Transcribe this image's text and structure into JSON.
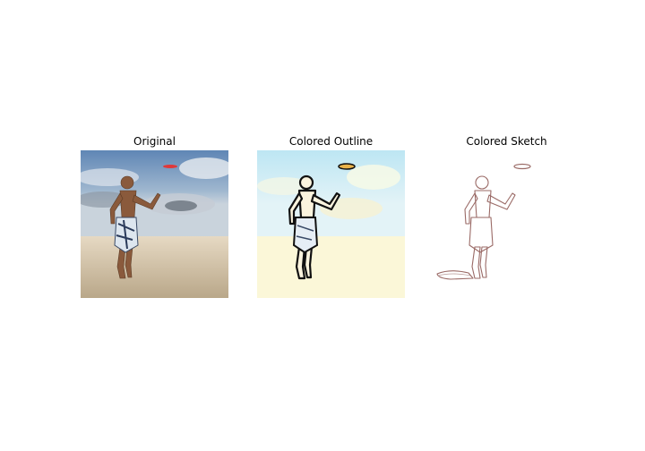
{
  "figure": {
    "panels": [
      {
        "title": "Original"
      },
      {
        "title": "Colored Outline"
      },
      {
        "title": "Colored Sketch"
      }
    ]
  },
  "colors": {
    "sky_blue": "#7fa3c8",
    "sand": "#d9c9ae",
    "skin": "#8a5a3c",
    "frisbee": "#e0383a",
    "outline_sky": "#bfe7f2",
    "outline_sand": "#fbf6d9",
    "sketch_line": "#9a6a66"
  }
}
